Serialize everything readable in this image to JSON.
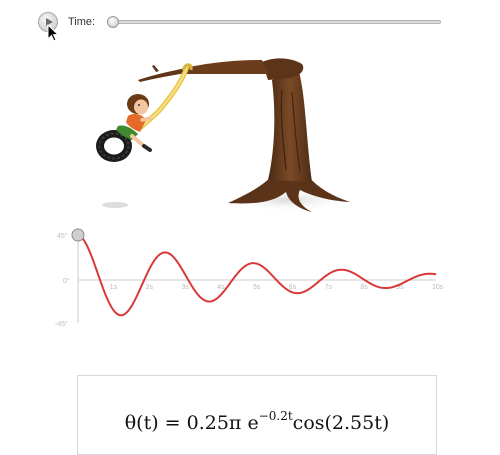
{
  "controls": {
    "time_label": "Time:",
    "time_value": 0,
    "time_max": 10
  },
  "graph": {
    "y_labels": {
      "top": "45°",
      "mid": "0°",
      "bottom": "-45°"
    },
    "x_labels": [
      "1s",
      "2s",
      "3s",
      "4s",
      "5s",
      "6s",
      "7s",
      "8s",
      "9s",
      "10s"
    ],
    "curve_color": "#d83a3a",
    "axis_color": "#cccccc",
    "label_color": "#bbbbbb"
  },
  "equation": {
    "lhs": "θ(t) = 0.25π e",
    "exponent": "−0.2t",
    "rhs": "cos(2.55t)"
  },
  "chart_data": {
    "type": "line",
    "x_unit": "s",
    "xlim": [
      0,
      10
    ],
    "ylim": [
      -45,
      45
    ],
    "function": "theta(t) = 0.25*pi*exp(-0.2*t)*cos(2.55*t)",
    "amplitude_deg": 45,
    "decay": 0.2,
    "omega": 2.55,
    "series": [
      {
        "values_x": [
          0,
          1,
          2,
          3,
          4,
          5,
          6,
          7,
          8,
          9,
          10
        ],
        "values_y": [
          45,
          -30.7,
          14.0,
          4.2,
          -15.2,
          16.5,
          -11.3,
          4.1,
          1.6,
          -4.6,
          5.0
        ]
      }
    ]
  }
}
